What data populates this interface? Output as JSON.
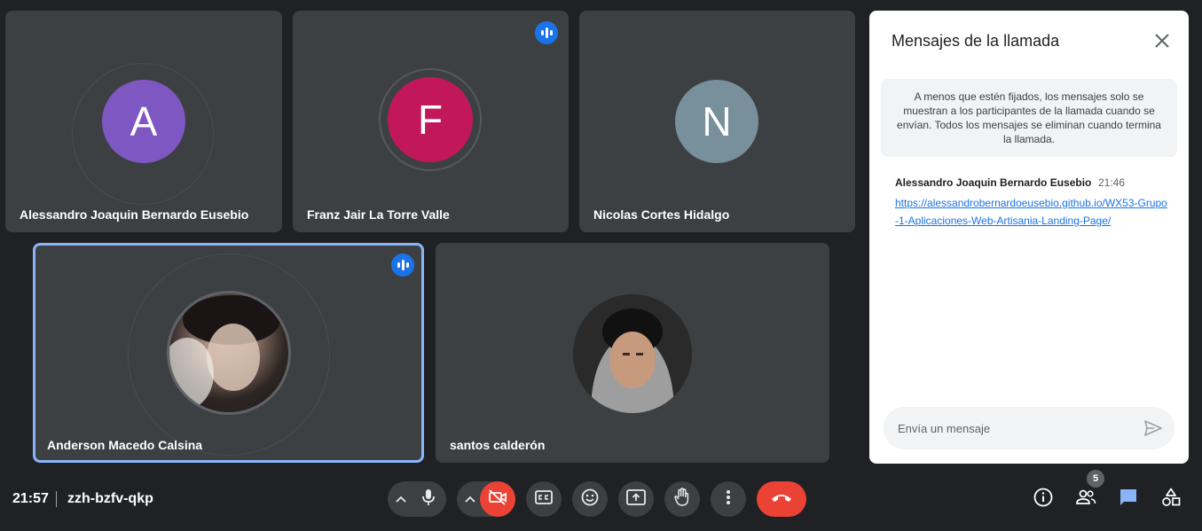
{
  "participants": [
    {
      "name": "Alessandro Joaquin Bernardo Eusebio",
      "initial": "A",
      "color": "#7e57c2",
      "speaking": false
    },
    {
      "name": "Franz Jair La Torre Valle",
      "initial": "F",
      "color": "#c2185b",
      "speaking": true
    },
    {
      "name": "Nicolas Cortes Hidalgo",
      "initial": "N",
      "color": "#78909c",
      "speaking": false
    },
    {
      "name": "Anderson Macedo Calsina",
      "speaking": true,
      "active": true
    },
    {
      "name": "santos calderón",
      "speaking": false
    }
  ],
  "chat": {
    "title": "Mensajes de la llamada",
    "notice": "A menos que estén fijados, los mensajes solo se muestran a los participantes de la llamada cuando se envían. Todos los mensajes se eliminan cuando termina la llamada.",
    "messages": [
      {
        "sender": "Alessandro Joaquin Bernardo Eusebio",
        "time": "21:46",
        "text": "https://alessandrobernardoeusebio.github.io/WX53-Grupo-1-Aplicaciones-Web-Artisania-Landing-Page/"
      }
    ],
    "input_placeholder": "Envía un mensaje"
  },
  "bottom_bar": {
    "time": "21:57",
    "meeting_code": "zzh-bzfv-qkp",
    "people_count": "5"
  },
  "icons": [
    "speaking-icon",
    "close-icon",
    "send-icon",
    "chevron-up-icon",
    "microphone-icon",
    "camera-off-icon",
    "captions-icon",
    "emoji-icon",
    "present-screen-icon",
    "raise-hand-icon",
    "more-options-icon",
    "end-call-icon",
    "info-icon",
    "people-icon",
    "chat-icon",
    "activities-icon"
  ],
  "colors": {
    "background": "#202124",
    "tile": "#3c4043",
    "accent": "#1a73e8",
    "danger": "#ea4335",
    "active_outline": "#8ab4f8"
  }
}
